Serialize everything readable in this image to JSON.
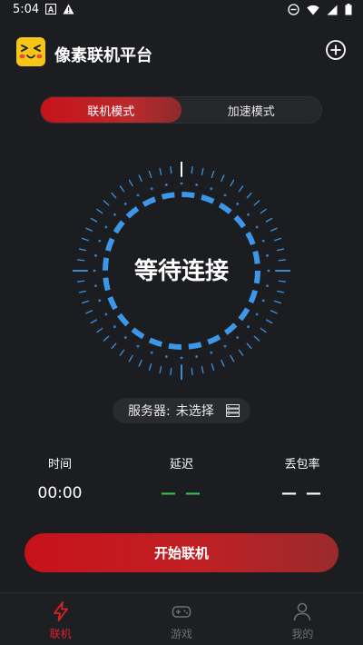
{
  "status_bar": {
    "time": "5:04",
    "left_icons": [
      "notification-a-icon",
      "warning-icon"
    ],
    "right_icons": [
      "do-not-disturb-icon",
      "wifi-icon",
      "cellular-icon",
      "battery-icon"
    ]
  },
  "header": {
    "title": "像素联机平台",
    "logo": "pixel-face-logo",
    "action_icon": "add-circle-icon"
  },
  "mode_tabs": [
    {
      "label": "联机模式",
      "active": true
    },
    {
      "label": "加速模式",
      "active": false
    }
  ],
  "dial": {
    "status_text": "等待连接",
    "accent_color": "#3d97e8"
  },
  "server": {
    "label": "服务器:",
    "value": "未选择",
    "icon": "server-list-icon"
  },
  "stats": [
    {
      "label": "时间",
      "value": "00:00"
    },
    {
      "label": "延迟",
      "value": "— —"
    },
    {
      "label": "丢包率",
      "value": "— —"
    }
  ],
  "start_button": {
    "label": "开始联机"
  },
  "bottom_nav": [
    {
      "label": "联机",
      "icon": "lightning-icon",
      "active": true
    },
    {
      "label": "游戏",
      "icon": "gamepad-icon",
      "active": false
    },
    {
      "label": "我的",
      "icon": "person-icon",
      "active": false
    }
  ],
  "colors": {
    "background": "#1c1d20",
    "brand_red": "#c8121a",
    "accent_blue": "#3d97e8",
    "ping_green": "#3bbf54"
  }
}
